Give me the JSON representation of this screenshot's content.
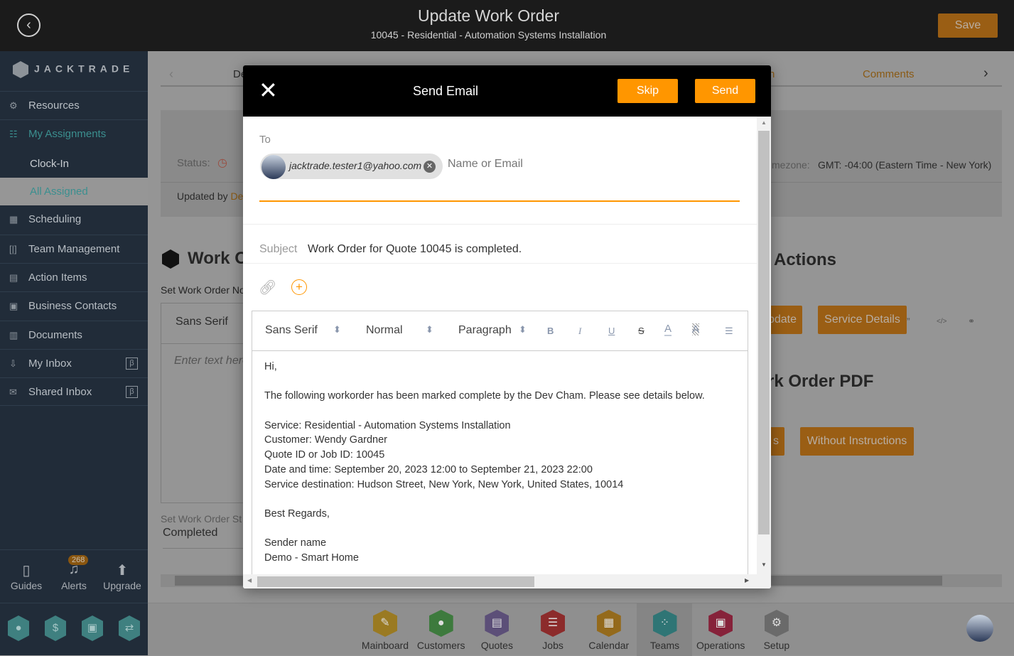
{
  "header": {
    "title": "Update Work Order",
    "subtitle": "10045 - Residential - Automation Systems Installation",
    "save": "Save"
  },
  "sidebar": {
    "logo": "JACKTRADE",
    "items": [
      {
        "label": "Resources",
        "icon": "resources-icon"
      },
      {
        "label": "My Assignments",
        "icon": "assignments-icon"
      },
      {
        "label": "Clock-In"
      },
      {
        "label": "All Assigned"
      },
      {
        "label": "Scheduling",
        "icon": "calendar-icon"
      },
      {
        "label": "Team Management",
        "icon": "team-icon"
      },
      {
        "label": "Action Items",
        "icon": "clipboard-icon"
      },
      {
        "label": "Business Contacts",
        "icon": "contacts-icon"
      },
      {
        "label": "Documents",
        "icon": "document-icon"
      },
      {
        "label": "My Inbox",
        "icon": "inbox-icon",
        "badge": "β"
      },
      {
        "label": "Shared Inbox",
        "icon": "mail-icon",
        "badge": "β"
      }
    ],
    "bottom": {
      "guides": "Guides",
      "alerts": "Alerts",
      "alerts_count": "268",
      "upgrade": "Upgrade"
    }
  },
  "page": {
    "tab_first": "De",
    "tab_partial": "n",
    "tab_comments": "Comments",
    "status_label": "Status:",
    "updated_by": "Updated by ",
    "updated_by_name": "Dev",
    "timezone_label": "mezone:",
    "timezone_value": "GMT: -04:00 (Eastern Time - New York)",
    "work_order_heading": "Work O",
    "notes_label": "Set Work Order No",
    "notes_font": "Sans Serif",
    "notes_placeholder": "Enter text here",
    "status_select_label": "Set Work Order St",
    "status_value": "Completed",
    "actions_heading": "Actions",
    "update_btn": "pdate",
    "service_details_btn": "Service Details",
    "pdf_heading": "rk Order PDF",
    "with_btn": "s",
    "without_btn": "Without Instructions"
  },
  "modal": {
    "title": "Send Email",
    "skip": "Skip",
    "send": "Send",
    "to_label": "To",
    "recipient": "jacktrade.tester1@yahoo.com",
    "to_placeholder": "Name or Email",
    "subject_label": "Subject",
    "subject": "Work Order for Quote 10045 is completed.",
    "toolbar": {
      "font": "Sans Serif",
      "size": "Normal",
      "format": "Paragraph"
    },
    "body": [
      "Hi,",
      "",
      "The following workorder has been marked complete by the Dev Cham. Please see details below.",
      "",
      "Service: Residential - Automation Systems Installation",
      "Customer: Wendy Gardner",
      "Quote ID or Job ID: 10045",
      "Date and time: September 20, 2023 12:00 to September 21, 2023 22:00",
      "Service destination: Hudson Street, New York, New York, United States, 10014",
      "",
      "Best Regards,",
      "",
      "Sender name",
      "Demo - Smart Home"
    ]
  },
  "apps": [
    {
      "label": "Mainboard",
      "color": "#9a7a22"
    },
    {
      "label": "Customers",
      "color": "#3d7a3d"
    },
    {
      "label": "Quotes",
      "color": "#5c4f78"
    },
    {
      "label": "Jobs",
      "color": "#8c2b2b"
    },
    {
      "label": "Calendar",
      "color": "#946a1c"
    },
    {
      "label": "Teams",
      "color": "#2f7575"
    },
    {
      "label": "Operations",
      "color": "#86223a"
    },
    {
      "label": "Setup",
      "color": "#6a6a6a"
    }
  ]
}
